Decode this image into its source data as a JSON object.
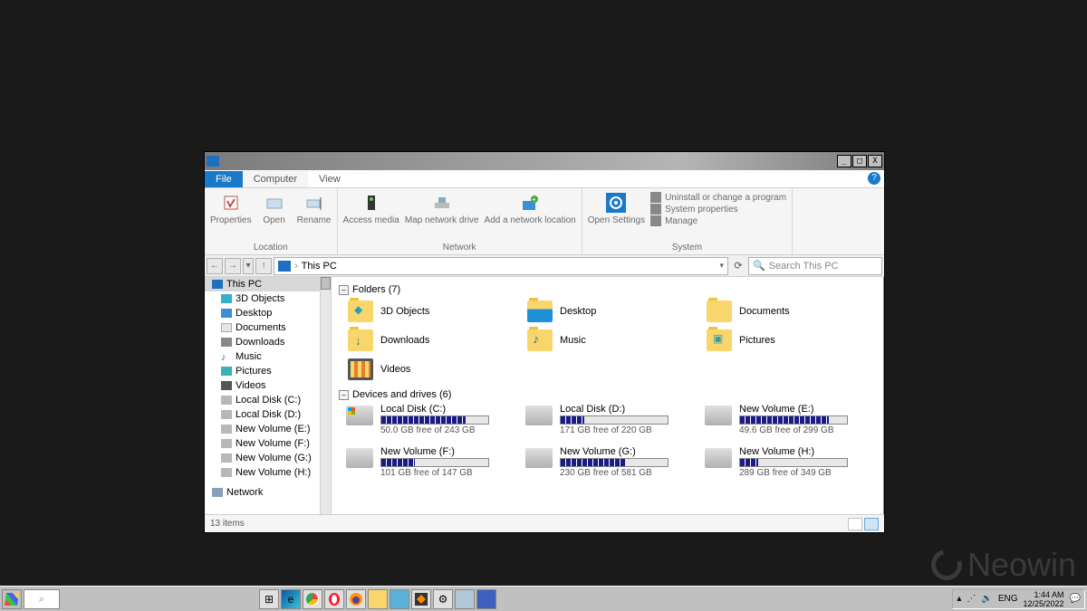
{
  "window": {
    "tabs": {
      "file": "File",
      "computer": "Computer",
      "view": "View"
    },
    "ribbon": {
      "location": {
        "label": "Location",
        "properties": "Properties",
        "open": "Open",
        "rename": "Rename"
      },
      "network": {
        "label": "Network",
        "access": "Access media",
        "map": "Map network drive",
        "add": "Add a network location"
      },
      "system": {
        "label": "System",
        "settings": "Open Settings",
        "uninstall": "Uninstall or change a program",
        "props": "System properties",
        "manage": "Manage"
      }
    },
    "address": "This PC",
    "search_placeholder": "Search This PC"
  },
  "tree": [
    {
      "label": "This PC",
      "icon": "pc",
      "selected": true
    },
    {
      "label": "3D Objects",
      "icon": "obj3d"
    },
    {
      "label": "Desktop",
      "icon": "desk"
    },
    {
      "label": "Documents",
      "icon": "doc"
    },
    {
      "label": "Downloads",
      "icon": "dl"
    },
    {
      "label": "Music",
      "icon": "music"
    },
    {
      "label": "Pictures",
      "icon": "pic"
    },
    {
      "label": "Videos",
      "icon": "vid"
    },
    {
      "label": "Local Disk (C:)",
      "icon": "disk"
    },
    {
      "label": "Local Disk (D:)",
      "icon": "disk"
    },
    {
      "label": "New Volume (E:)",
      "icon": "disk"
    },
    {
      "label": "New Volume (F:)",
      "icon": "disk"
    },
    {
      "label": "New Volume (G:)",
      "icon": "disk"
    },
    {
      "label": "New Volume (H:)",
      "icon": "disk"
    },
    {
      "label": "Network",
      "icon": "net"
    }
  ],
  "folders": {
    "header": "Folders (7)",
    "items": [
      {
        "name": "3D Objects",
        "cls": "obj3d"
      },
      {
        "name": "Desktop",
        "cls": "desk"
      },
      {
        "name": "Documents",
        "cls": ""
      },
      {
        "name": "Downloads",
        "cls": "dl"
      },
      {
        "name": "Music",
        "cls": "music"
      },
      {
        "name": "Pictures",
        "cls": "pic"
      },
      {
        "name": "Videos",
        "cls": "vid"
      }
    ]
  },
  "drives": {
    "header": "Devices and drives (6)",
    "items": [
      {
        "name": "Local Disk (C:)",
        "free": "50.0 GB free of 243 GB",
        "pct": 79,
        "os": true
      },
      {
        "name": "Local Disk (D:)",
        "free": "171 GB free of 220 GB",
        "pct": 22
      },
      {
        "name": "New Volume (E:)",
        "free": "49.6 GB free of 299 GB",
        "pct": 83
      },
      {
        "name": "New Volume (F:)",
        "free": "101 GB free of 147 GB",
        "pct": 31
      },
      {
        "name": "New Volume (G:)",
        "free": "230 GB free of 581 GB",
        "pct": 60
      },
      {
        "name": "New Volume (H:)",
        "free": "289 GB free of 349 GB",
        "pct": 17
      }
    ]
  },
  "status": "13 items",
  "taskbar": {
    "tray": {
      "lang": "ENG",
      "time": "1:44 AM",
      "date": "12/25/2022"
    }
  },
  "watermark": "Neowin"
}
